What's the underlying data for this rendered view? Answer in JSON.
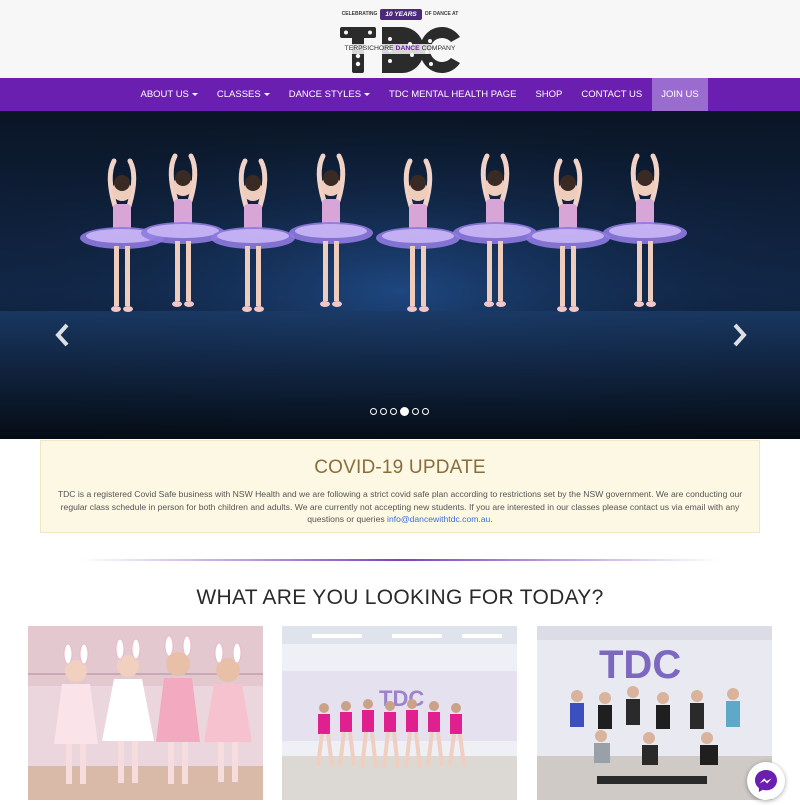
{
  "logo": {
    "celebrating": "CELEBRATING",
    "years": "10 YEARS",
    "of_dance": "OF DANCE AT",
    "letters": "TDC",
    "sub_left": "TERPSICHORE ",
    "sub_mid": "DANCE",
    "sub_right": " COMPANY"
  },
  "nav": {
    "items": [
      {
        "label": "ABOUT US",
        "dropdown": true
      },
      {
        "label": "CLASSES",
        "dropdown": true
      },
      {
        "label": "DANCE STYLES",
        "dropdown": true
      },
      {
        "label": "TDC MENTAL HEALTH PAGE",
        "dropdown": false
      },
      {
        "label": "SHOP",
        "dropdown": false
      },
      {
        "label": "CONTACT US",
        "dropdown": false
      },
      {
        "label": "JOIN US",
        "dropdown": false,
        "active": true
      }
    ]
  },
  "hero": {
    "prev_icon": "chevron-left-icon",
    "next_icon": "chevron-right-icon",
    "slide_count": 6,
    "active_slide": 4
  },
  "covid": {
    "title": "COVID-19 UPDATE",
    "body": "TDC is a registered Covid Safe business with NSW Health and we are following a strict covid safe plan according to restrictions set by the NSW government. We are conducting our regular class schedule in person for both children and adults. We are currently not accepting new students. If you are interested in our classes please contact us via email with any questions or queries ",
    "email": "info@dancewithtdc.com.au",
    "end": "."
  },
  "section": {
    "title": "WHAT ARE YOU LOOKING FOR TODAY?"
  },
  "messenger": {
    "icon": "messenger-icon"
  },
  "colors": {
    "brand_purple": "#6a1fb0",
    "active_nav": "#9b6cd0",
    "covid_bg": "#fcf8e3",
    "covid_title": "#8a6d3b",
    "link": "#3a6fd8"
  }
}
